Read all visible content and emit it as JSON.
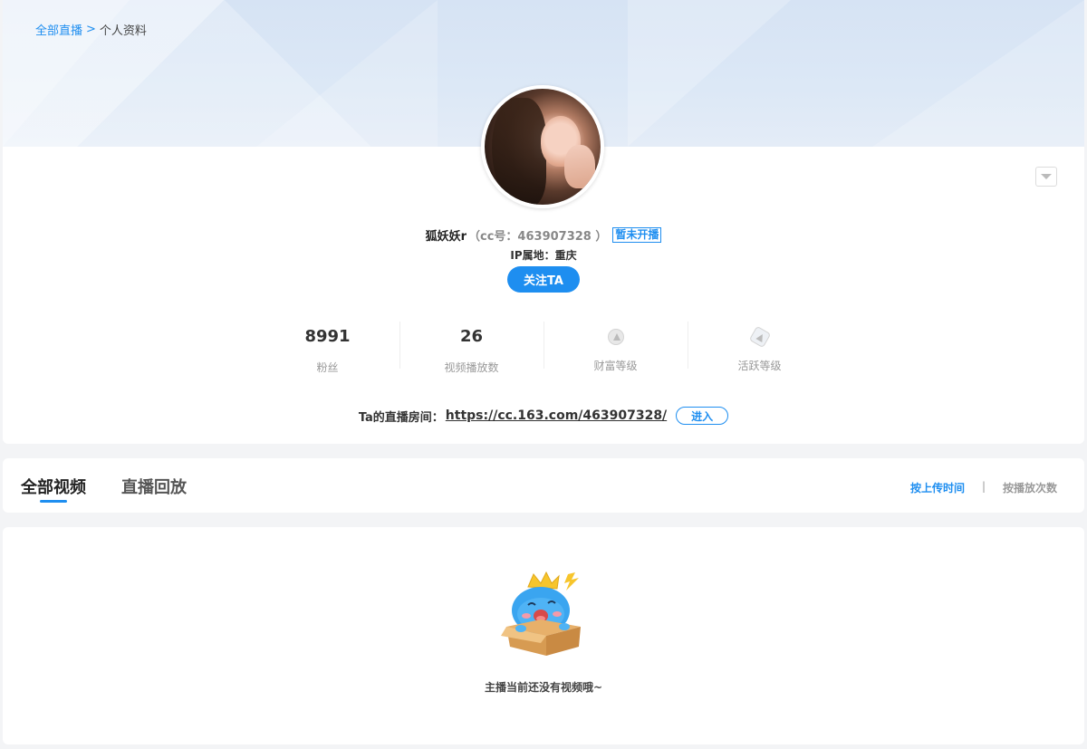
{
  "breadcrumb": {
    "root": "全部直播",
    "separator": ">",
    "current": "个人资料"
  },
  "profile": {
    "username": "狐妖妖r",
    "cc_id": "（cc号：463907328 ）",
    "live_status": "暂未开播",
    "ip_location": "IP属地：重庆",
    "follow_label": "关注TA"
  },
  "stats": [
    {
      "value": "8991",
      "label": "粉丝"
    },
    {
      "value": "26",
      "label": "视频播放数"
    },
    {
      "value": "",
      "label": "财富等级",
      "icon": "wealth-level-icon"
    },
    {
      "value": "",
      "label": "活跃等级",
      "icon": "activity-level-icon"
    }
  ],
  "room": {
    "label": "Ta的直播房间：",
    "url": "https://cc.163.com/463907328/",
    "enter_label": "进入"
  },
  "tabs": {
    "all_videos": "全部视频",
    "replay": "直播回放"
  },
  "sort": {
    "by_upload": "按上传时间",
    "separator": "|",
    "by_plays": "按播放次数"
  },
  "empty": {
    "message": "主播当前还没有视频哦~"
  },
  "colors": {
    "accent": "#1e8ef0",
    "banner": "#d6e3f4"
  }
}
